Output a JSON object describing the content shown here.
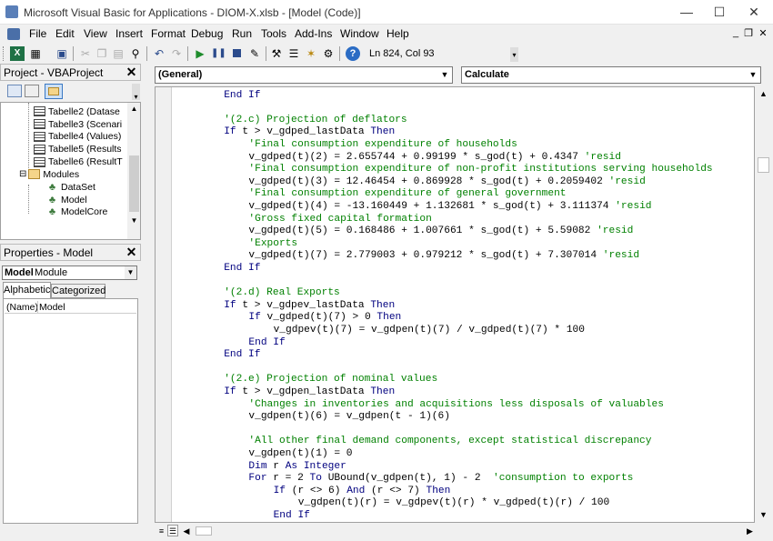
{
  "window": {
    "title": "Microsoft Visual Basic for Applications - DIOM-X.xlsb - [Model (Code)]",
    "min_glyph": "—",
    "max_glyph": "☐",
    "close_glyph": "✕"
  },
  "menu": [
    "File",
    "Edit",
    "View",
    "Insert",
    "Format",
    "Debug",
    "Run",
    "Tools",
    "Add-Ins",
    "Window",
    "Help"
  ],
  "mdi_controls": {
    "min": "_",
    "restore": "❐",
    "close": "✕"
  },
  "toolbar": {
    "position": "Ln 824, Col 93"
  },
  "project_pane": {
    "title": "Project - VBAProject",
    "items": [
      {
        "label": "Tabelle2 (Datase",
        "icon": "sheet-icon"
      },
      {
        "label": "Tabelle3 (Scenari",
        "icon": "sheet-icon"
      },
      {
        "label": "Tabelle4 (Values)",
        "icon": "sheet-icon"
      },
      {
        "label": "Tabelle5 (Results",
        "icon": "sheet-icon"
      },
      {
        "label": "Tabelle6 (ResultT",
        "icon": "sheet-icon"
      },
      {
        "label": "Modules",
        "icon": "folder-icon",
        "expander": "⊟"
      },
      {
        "label": "DataSet",
        "icon": "module-icon"
      },
      {
        "label": "Model",
        "icon": "module-icon"
      },
      {
        "label": "ModelCore",
        "icon": "module-icon"
      }
    ]
  },
  "properties_pane": {
    "title": "Properties - Model",
    "object_name": "Model",
    "object_type": "Module",
    "tabs": [
      "Alphabetic",
      "Categorized"
    ],
    "rows": [
      {
        "name": "(Name)",
        "value": "Model"
      }
    ]
  },
  "code_window": {
    "object_combo": "(General)",
    "proc_combo": "Calculate",
    "lines": [
      {
        "i": 1,
        "parts": [
          [
            "kw",
            "End If"
          ]
        ]
      },
      {
        "i": 0,
        "parts": []
      },
      {
        "i": 1,
        "parts": [
          [
            "cm",
            "'(2.c) Projection of deflators"
          ]
        ]
      },
      {
        "i": 1,
        "parts": [
          [
            "kw",
            "If "
          ],
          [
            "tx",
            "t > v_gdped_lastData "
          ],
          [
            "kw",
            "Then"
          ]
        ]
      },
      {
        "i": 2,
        "parts": [
          [
            "cm",
            "'Final consumption expenditure of households"
          ]
        ]
      },
      {
        "i": 2,
        "parts": [
          [
            "tx",
            "v_gdped(t)(2) = 2.655744 + 0.99199 * s_god(t) + 0.4347 "
          ],
          [
            "cm",
            "'resid"
          ]
        ]
      },
      {
        "i": 2,
        "parts": [
          [
            "cm",
            "'Final consumption expenditure of non-profit institutions serving households"
          ]
        ]
      },
      {
        "i": 2,
        "parts": [
          [
            "tx",
            "v_gdped(t)(3) = 12.46454 + 0.869928 * s_god(t) + 0.2059402 "
          ],
          [
            "cm",
            "'resid"
          ]
        ]
      },
      {
        "i": 2,
        "parts": [
          [
            "cm",
            "'Final consumption expenditure of general government"
          ]
        ]
      },
      {
        "i": 2,
        "parts": [
          [
            "tx",
            "v_gdped(t)(4) = -13.160449 + 1.132681 * s_god(t) + 3.111374 "
          ],
          [
            "cm",
            "'resid"
          ]
        ]
      },
      {
        "i": 2,
        "parts": [
          [
            "cm",
            "'Gross fixed capital formation"
          ]
        ]
      },
      {
        "i": 2,
        "parts": [
          [
            "tx",
            "v_gdped(t)(5) = 0.168486 + 1.007661 * s_god(t) + 5.59082 "
          ],
          [
            "cm",
            "'resid"
          ]
        ]
      },
      {
        "i": 2,
        "parts": [
          [
            "cm",
            "'Exports"
          ]
        ]
      },
      {
        "i": 2,
        "parts": [
          [
            "tx",
            "v_gdped(t)(7) = 2.779003 + 0.979212 * s_god(t) + 7.307014 "
          ],
          [
            "cm",
            "'resid"
          ]
        ]
      },
      {
        "i": 1,
        "parts": [
          [
            "kw",
            "End If"
          ]
        ]
      },
      {
        "i": 0,
        "parts": []
      },
      {
        "i": 1,
        "parts": [
          [
            "cm",
            "'(2.d) Real Exports"
          ]
        ]
      },
      {
        "i": 1,
        "parts": [
          [
            "kw",
            "If "
          ],
          [
            "tx",
            "t > v_gdpev_lastData "
          ],
          [
            "kw",
            "Then"
          ]
        ]
      },
      {
        "i": 2,
        "parts": [
          [
            "kw",
            "If "
          ],
          [
            "tx",
            "v_gdped(t)(7) > 0 "
          ],
          [
            "kw",
            "Then"
          ]
        ]
      },
      {
        "i": 3,
        "parts": [
          [
            "tx",
            "v_gdpev(t)(7) = v_gdpen(t)(7) / v_gdped(t)(7) * 100"
          ]
        ]
      },
      {
        "i": 2,
        "parts": [
          [
            "kw",
            "End If"
          ]
        ]
      },
      {
        "i": 1,
        "parts": [
          [
            "kw",
            "End If"
          ]
        ]
      },
      {
        "i": 0,
        "parts": []
      },
      {
        "i": 1,
        "parts": [
          [
            "cm",
            "'(2.e) Projection of nominal values"
          ]
        ]
      },
      {
        "i": 1,
        "parts": [
          [
            "kw",
            "If "
          ],
          [
            "tx",
            "t > v_gdpen_lastData "
          ],
          [
            "kw",
            "Then"
          ]
        ]
      },
      {
        "i": 2,
        "parts": [
          [
            "cm",
            "'Changes in inventories and acquisitions less disposals of valuables"
          ]
        ]
      },
      {
        "i": 2,
        "parts": [
          [
            "tx",
            "v_gdpen(t)(6) = v_gdpen(t - 1)(6)"
          ]
        ]
      },
      {
        "i": 0,
        "parts": []
      },
      {
        "i": 2,
        "parts": [
          [
            "cm",
            "'All other final demand components, except statistical discrepancy"
          ]
        ]
      },
      {
        "i": 2,
        "parts": [
          [
            "tx",
            "v_gdpen(t)(1) = 0"
          ]
        ]
      },
      {
        "i": 2,
        "parts": [
          [
            "kw",
            "Dim "
          ],
          [
            "tx",
            "r "
          ],
          [
            "kw",
            "As Integer"
          ]
        ]
      },
      {
        "i": 2,
        "parts": [
          [
            "kw",
            "For "
          ],
          [
            "tx",
            "r = 2 "
          ],
          [
            "kw",
            "To "
          ],
          [
            "tx",
            "UBound(v_gdpen(t), 1) - 2  "
          ],
          [
            "cm",
            "'consumption to exports"
          ]
        ]
      },
      {
        "i": 3,
        "parts": [
          [
            "kw",
            "If "
          ],
          [
            "tx",
            "(r <> 6) "
          ],
          [
            "kw",
            "And "
          ],
          [
            "tx",
            "(r <> 7) "
          ],
          [
            "kw",
            "Then"
          ]
        ]
      },
      {
        "i": 4,
        "parts": [
          [
            "tx",
            "v_gdpen(t)(r) = v_gdpev(t)(r) * v_gdped(t)(r) / 100"
          ]
        ]
      },
      {
        "i": 3,
        "parts": [
          [
            "kw",
            "End If"
          ]
        ]
      }
    ]
  }
}
